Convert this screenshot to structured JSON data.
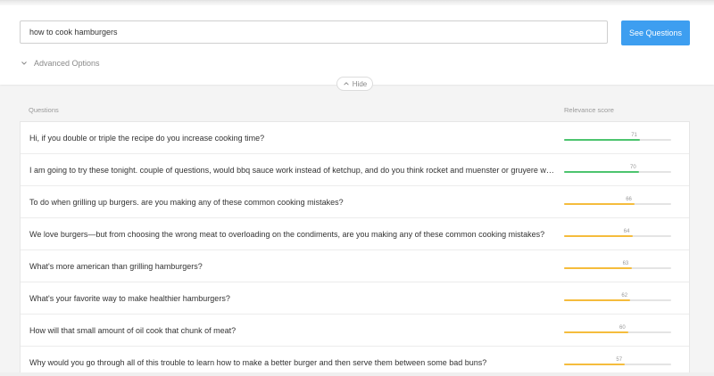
{
  "search": {
    "value": "how to cook hamburgers",
    "button_label": "See Questions"
  },
  "advanced_options": {
    "label": "Advanced Options"
  },
  "hide": {
    "label": "Hide"
  },
  "table": {
    "headers": {
      "questions": "Questions",
      "relevance": "Relevance score"
    },
    "rows": [
      {
        "question": "Hi, if you double or triple the recipe do you increase cooking time?",
        "score": 71,
        "color": "#4cc46e"
      },
      {
        "question": "I am going to try these tonight. couple of questions, would bbq sauce work instead of ketchup, and do you think rocket and muenster or gruyere would have a nice combo?",
        "score": 70,
        "color": "#4cc46e"
      },
      {
        "question": "To do when grilling up burgers. are you making any of these common cooking mistakes?",
        "score": 66,
        "color": "#f5bc3c"
      },
      {
        "question": "We love burgers—but from choosing the wrong meat to overloading on the condiments, are you making any of these common cooking mistakes?",
        "score": 64,
        "color": "#f5bc3c"
      },
      {
        "question": "What's more american than grilling hamburgers?",
        "score": 63,
        "color": "#f5bc3c"
      },
      {
        "question": "What's your favorite way to make healthier hamburgers?",
        "score": 62,
        "color": "#f5bc3c"
      },
      {
        "question": "How will that small amount of oil cook that chunk of meat?",
        "score": 60,
        "color": "#f5bc3c"
      },
      {
        "question": "Why would you go through all of this trouble to learn how to make a better burger and then serve them between some bad buns?",
        "score": 57,
        "color": "#f5bc3c"
      }
    ]
  }
}
